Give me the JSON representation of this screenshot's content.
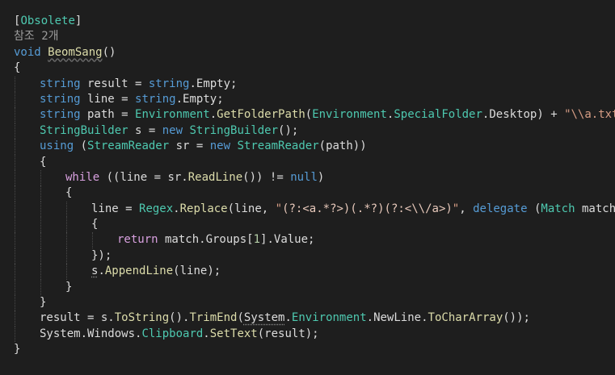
{
  "editor": {
    "lines": [
      {
        "indent": 0,
        "tokens": [
          [
            "[",
            "plain"
          ],
          [
            "Obsolete",
            "type"
          ],
          [
            "]",
            "plain"
          ]
        ]
      },
      {
        "indent": 0,
        "tokens": [
          [
            "참조 2개",
            "meta"
          ]
        ]
      },
      {
        "indent": 0,
        "tokens": [
          [
            "void",
            "kw"
          ],
          [
            " ",
            "plain"
          ],
          [
            "BeomSang",
            "method",
            "sq"
          ],
          [
            "()",
            "plain"
          ]
        ]
      },
      {
        "indent": 0,
        "tokens": [
          [
            "{",
            "plain"
          ]
        ]
      },
      {
        "indent": 1,
        "tokens": [
          [
            "string",
            "kw"
          ],
          [
            " result = ",
            "plain"
          ],
          [
            "string",
            "kw"
          ],
          [
            ".",
            "plain"
          ],
          [
            "Empty",
            "plain"
          ],
          [
            ";",
            "plain"
          ]
        ]
      },
      {
        "indent": 1,
        "tokens": [
          [
            "string",
            "kw"
          ],
          [
            " line = ",
            "plain"
          ],
          [
            "string",
            "kw"
          ],
          [
            ".",
            "plain"
          ],
          [
            "Empty",
            "plain"
          ],
          [
            ";",
            "plain"
          ]
        ]
      },
      {
        "indent": 1,
        "tokens": [
          [
            "string",
            "kw"
          ],
          [
            " path = ",
            "plain"
          ],
          [
            "Environment",
            "type"
          ],
          [
            ".",
            "plain"
          ],
          [
            "GetFolderPath",
            "method"
          ],
          [
            "(",
            "plain"
          ],
          [
            "Environment",
            "type"
          ],
          [
            ".",
            "plain"
          ],
          [
            "SpecialFolder",
            "type"
          ],
          [
            ".Desktop) + ",
            "plain"
          ],
          [
            "\"\\\\a.txt\"",
            "str"
          ],
          [
            ";",
            "plain"
          ]
        ]
      },
      {
        "indent": 1,
        "tokens": [
          [
            "StringBuilder",
            "type"
          ],
          [
            " s = ",
            "plain"
          ],
          [
            "new",
            "kw"
          ],
          [
            " ",
            "plain"
          ],
          [
            "StringBuilder",
            "type"
          ],
          [
            "();",
            "plain"
          ]
        ]
      },
      {
        "indent": 1,
        "tokens": [
          [
            "using",
            "kw"
          ],
          [
            " (",
            "plain"
          ],
          [
            "StreamReader",
            "type"
          ],
          [
            " sr = ",
            "plain"
          ],
          [
            "new",
            "kw"
          ],
          [
            " ",
            "plain"
          ],
          [
            "StreamReader",
            "type"
          ],
          [
            "(path))",
            "plain"
          ]
        ]
      },
      {
        "indent": 1,
        "tokens": [
          [
            "{",
            "plain"
          ]
        ]
      },
      {
        "indent": 2,
        "tokens": [
          [
            "while",
            "ctl"
          ],
          [
            " ((line = sr.",
            "plain"
          ],
          [
            "ReadLine",
            "method"
          ],
          [
            "()) != ",
            "plain"
          ],
          [
            "null",
            "kw"
          ],
          [
            ")",
            "plain"
          ]
        ]
      },
      {
        "indent": 2,
        "tokens": [
          [
            "{",
            "plain"
          ]
        ]
      },
      {
        "indent": 3,
        "tokens": [
          [
            "line = ",
            "plain"
          ],
          [
            "Regex",
            "type"
          ],
          [
            ".",
            "plain"
          ],
          [
            "Replace",
            "method"
          ],
          [
            "(line, ",
            "plain"
          ],
          [
            "\"",
            "str"
          ],
          [
            "(?:<a.*?>)(.*?)(?:<\\\\/a>)",
            "rx"
          ],
          [
            "\"",
            "str"
          ],
          [
            ", ",
            "plain"
          ],
          [
            "delegate",
            "kw"
          ],
          [
            " (",
            "plain"
          ],
          [
            "Match",
            "type"
          ],
          [
            " match)",
            "plain"
          ]
        ]
      },
      {
        "indent": 3,
        "tokens": [
          [
            "{",
            "plain"
          ]
        ]
      },
      {
        "indent": 4,
        "tokens": [
          [
            "return",
            "ctl"
          ],
          [
            " match.Groups[",
            "plain"
          ],
          [
            "1",
            "num"
          ],
          [
            "].Value;",
            "plain"
          ]
        ]
      },
      {
        "indent": 3,
        "tokens": [
          [
            "});",
            "plain"
          ]
        ]
      },
      {
        "indent": 3,
        "tokens": [
          [
            "s",
            "plain",
            "dot"
          ],
          [
            ".",
            "plain"
          ],
          [
            "AppendLine",
            "method"
          ],
          [
            "(line);",
            "plain"
          ]
        ]
      },
      {
        "indent": 2,
        "tokens": [
          [
            "}",
            "plain"
          ]
        ]
      },
      {
        "indent": 1,
        "tokens": [
          [
            "}",
            "plain"
          ]
        ]
      },
      {
        "indent": 1,
        "tokens": [
          [
            "result = s.",
            "plain"
          ],
          [
            "ToString",
            "method"
          ],
          [
            "().",
            "plain"
          ],
          [
            "TrimEnd",
            "method"
          ],
          [
            "(",
            "plain"
          ],
          [
            "System",
            "plain",
            "dot"
          ],
          [
            ".",
            "plain"
          ],
          [
            "Environment",
            "type"
          ],
          [
            ".",
            "plain"
          ],
          [
            "NewLine",
            "plain"
          ],
          [
            ".",
            "plain"
          ],
          [
            "ToCharArray",
            "method"
          ],
          [
            "());",
            "plain"
          ]
        ]
      },
      {
        "indent": 1,
        "tokens": [
          [
            "System.Windows.",
            "plain"
          ],
          [
            "Clipboard",
            "type"
          ],
          [
            ".",
            "plain"
          ],
          [
            "SetText",
            "method"
          ],
          [
            "(result);",
            "plain"
          ]
        ]
      },
      {
        "indent": 0,
        "tokens": [
          [
            "}",
            "plain"
          ]
        ]
      }
    ]
  }
}
